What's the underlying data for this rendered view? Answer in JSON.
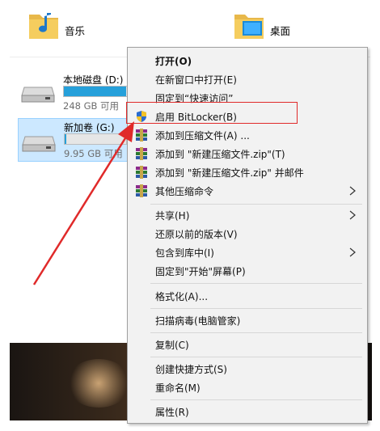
{
  "explorer": {
    "folders": [
      {
        "label": "音乐",
        "icon": "music-folder-icon"
      },
      {
        "label": "桌面",
        "icon": "desktop-folder-icon"
      }
    ],
    "drives": [
      {
        "name": "本地磁盘 (D:)",
        "free": "248 GB 可用",
        "fill_fraction": 0.55,
        "selected": false
      },
      {
        "name": "新加卷 (G:)",
        "free": "9.95 GB 可用",
        "fill_fraction": 0.02,
        "selected": true
      }
    ]
  },
  "context_menu": {
    "items": {
      "open": "打开(O)",
      "open_new_window": "在新窗口中打开(E)",
      "pin_quick_access": "固定到“快速访问”",
      "bitlocker": "启用 BitLocker(B)",
      "add_archive": "添加到压缩文件(A) ...",
      "add_zip": "添加到 \"新建压缩文件.zip\"(T)",
      "add_zip_email": "添加到 \"新建压缩文件.zip\" 并邮件",
      "other_compress": "其他压缩命令",
      "share": "共享(H)",
      "restore_versions": "还原以前的版本(V)",
      "include_library": "包含到库中(I)",
      "pin_start": "固定到\"开始\"屏幕(P)",
      "format": "格式化(A)...",
      "virus_scan": "扫描病毒(电脑管家)",
      "copy": "复制(C)",
      "create_shortcut": "创建快捷方式(S)",
      "rename": "重命名(M)",
      "properties": "属性(R)"
    }
  },
  "colors": {
    "annotation_red": "#e02a2a",
    "selection_blue": "#cce8ff",
    "usage_bar": "#26a0da"
  }
}
